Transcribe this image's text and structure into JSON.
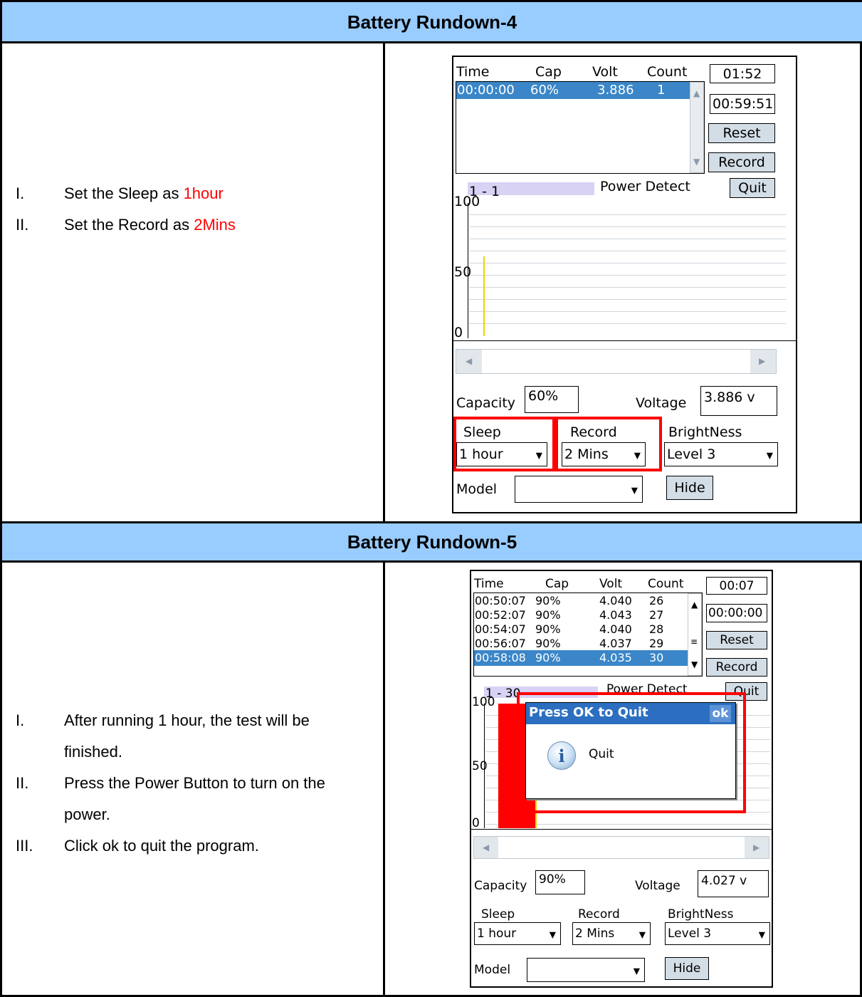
{
  "sections": [
    {
      "title": "Battery Rundown-4",
      "steps": [
        {
          "num": "I.",
          "text": "Set the Sleep as ",
          "highlight": "1hour"
        },
        {
          "num": "II.",
          "text": "Set the Record as ",
          "highlight": "2Mins"
        }
      ],
      "screen": {
        "list_headers": [
          "Time",
          "Cap",
          "Volt",
          "Count"
        ],
        "rows": [
          [
            "00:00:00",
            "60%",
            "3.886",
            "1"
          ]
        ],
        "elapsed": "01:52",
        "remaining": "00:59:51",
        "reset_label": "Reset",
        "record_label": "Record",
        "quit_label": "Quit",
        "graph_label": "1 - 1",
        "power_detect": "Power Detect",
        "y_ticks": [
          "100",
          "50",
          "0"
        ],
        "capacity_label": "Capacity",
        "capacity_value": "60%",
        "voltage_label": "Voltage",
        "voltage_value": "3.886 v",
        "sleep_label": "Sleep",
        "sleep_value": "1 hour",
        "record_combo_label": "Record",
        "record_value": "2 Mins",
        "brightness_label": "BrightNess",
        "brightness_value": "Level 3",
        "model_label": "Model",
        "hide_label": "Hide"
      }
    },
    {
      "title": "Battery Rundown-5",
      "steps": [
        {
          "num": "I.",
          "text": "After running 1 hour, the test will be finished."
        },
        {
          "num": "II.",
          "text": "Press the Power Button to turn on the power."
        },
        {
          "num": "III.",
          "text": "Click ok to quit the program."
        }
      ],
      "screen": {
        "list_headers": [
          "Time",
          "Cap",
          "Volt",
          "Count"
        ],
        "rows": [
          [
            "00:50:07",
            "90%",
            "4.040",
            "26"
          ],
          [
            "00:52:07",
            "90%",
            "4.043",
            "27"
          ],
          [
            "00:54:07",
            "90%",
            "4.040",
            "28"
          ],
          [
            "00:56:07",
            "90%",
            "4.037",
            "29"
          ],
          [
            "00:58:08",
            "90%",
            "4.035",
            "30"
          ]
        ],
        "elapsed": "00:07",
        "remaining": "00:00:00",
        "reset_label": "Reset",
        "record_label": "Record",
        "quit_label": "Quit",
        "graph_label": "1 - 30",
        "power_detect": "Power Detect",
        "y_ticks": [
          "100",
          "50",
          "0"
        ],
        "dialog_title": "Press OK to Quit",
        "dialog_ok": "ok",
        "dialog_message": "Quit",
        "capacity_label": "Capacity",
        "capacity_value": "90%",
        "voltage_label": "Voltage",
        "voltage_value": "4.027 v",
        "sleep_label": "Sleep",
        "sleep_value": "1 hour",
        "record_combo_label": "Record",
        "record_value": "2 Mins",
        "brightness_label": "BrightNess",
        "brightness_value": "Level 3",
        "model_label": "Model",
        "hide_label": "Hide"
      }
    }
  ],
  "colors": {
    "header_bg": "#99ccff",
    "highlight_text": "#ff0000",
    "selection": "#3a86c8",
    "callout": "#ff0000"
  }
}
